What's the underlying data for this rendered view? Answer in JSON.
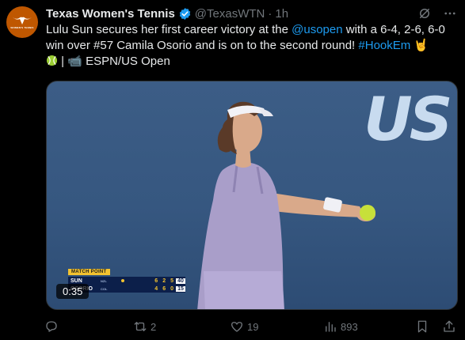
{
  "tweet": {
    "author_name": "Texas Women's Tennis",
    "handle": "@TexasWTN",
    "separator": "·",
    "time": "1h",
    "text_part1": "Lulu Sun secures her first career victory at the ",
    "mention": "@usopen",
    "text_part2": " with a 6-4, 2-6, 6-0 win over #57 Camila Osorio and is on to the second round! ",
    "hashtag": "#HookEm",
    "text_part3": " 🤘",
    "text_line2": " | 📹 ESPN/US Open",
    "avatar_text": "WOMEN'S TENNIS"
  },
  "media": {
    "logo_text": "US",
    "duration": "0:35",
    "scoreboard": {
      "label": "MATCH POINT",
      "rows": [
        {
          "name": "SUN",
          "country": "NZL",
          "sets": [
            "6",
            "2",
            "5"
          ],
          "points": "40"
        },
        {
          "name": "OSORIO",
          "country": "COL",
          "sets": [
            "4",
            "6",
            "0"
          ],
          "points": "15"
        }
      ]
    }
  },
  "actions": {
    "reply_count": "",
    "retweet_count": "2",
    "like_count": "19",
    "views_count": "893"
  },
  "colors": {
    "accent": "#1d9bf0",
    "muted": "#71767b",
    "text": "#e7e9ea",
    "brand_orange": "#bf5700",
    "court_blue": "#3c5d86"
  },
  "icons": [
    "verified-badge-icon",
    "grok-icon",
    "more-icon",
    "tennis-ball-emoji",
    "reply-icon",
    "retweet-icon",
    "like-icon",
    "views-icon",
    "bookmark-icon",
    "share-icon"
  ]
}
